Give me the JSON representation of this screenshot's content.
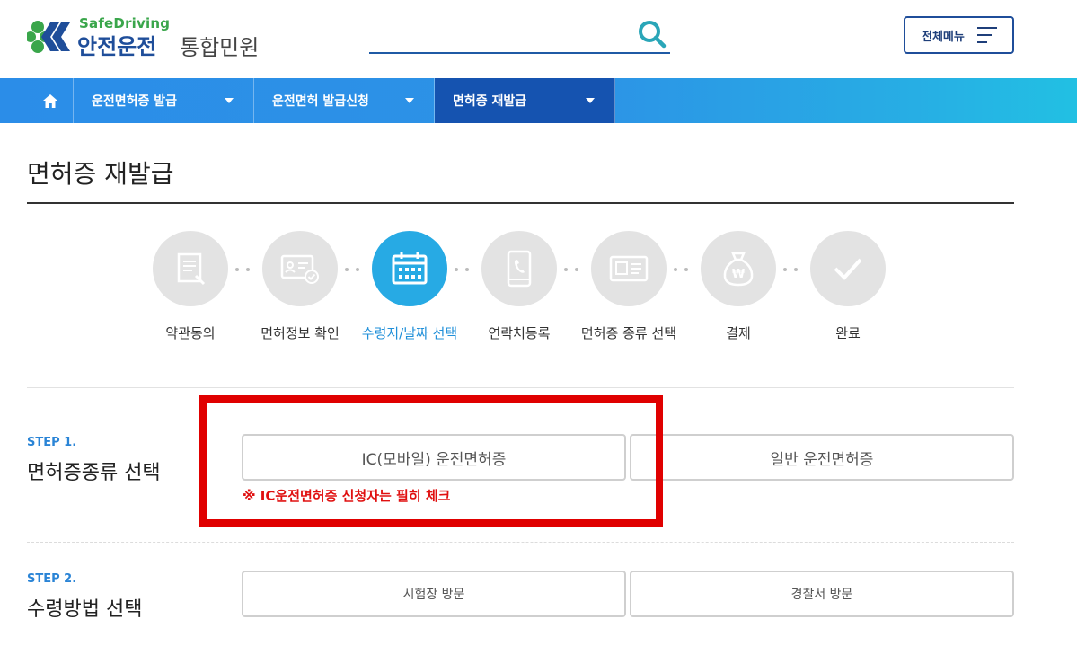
{
  "header": {
    "logo_safe": "SafeDriving",
    "logo_main": "안전운전",
    "logo_sub": "통합민원",
    "search_placeholder": "",
    "menu_label": "전체메뉴"
  },
  "nav": {
    "home_icon": "home-icon",
    "items": [
      {
        "label": "운전면허증 발급",
        "active": false
      },
      {
        "label": "운전면허 발급신청",
        "active": false
      },
      {
        "label": "면허증 재발급",
        "active": true
      }
    ]
  },
  "page": {
    "title": "면허증 재발급"
  },
  "progress": {
    "steps": [
      {
        "label": "약관동의",
        "icon": "document-edit-icon",
        "active": false
      },
      {
        "label": "면허정보 확인",
        "icon": "id-card-check-icon",
        "active": false
      },
      {
        "label": "수령지/날짜 선택",
        "icon": "calendar-icon",
        "active": true
      },
      {
        "label": "연락처등록",
        "icon": "phone-icon",
        "active": false
      },
      {
        "label": "면허증 종류 선택",
        "icon": "id-card-icon",
        "active": false
      },
      {
        "label": "결제",
        "icon": "money-bag-icon",
        "active": false
      },
      {
        "label": "완료",
        "icon": "check-icon",
        "active": false
      }
    ]
  },
  "step1": {
    "tag": "STEP 1.",
    "heading": "면허증종류 선택",
    "options": [
      "IC(모바일) 운전면허증",
      "일반 운전면허증"
    ],
    "notice": "※ IC운전면허증 신청자는 필히 체크"
  },
  "step2": {
    "tag": "STEP 2.",
    "heading": "수령방법 선택",
    "options": [
      "시험장 방문",
      "경찰서 방문"
    ]
  },
  "colors": {
    "primary": "#1f4e9a",
    "nav_gradient_start": "#2b8de8",
    "nav_active": "#1553b0",
    "step_active": "#27aae4",
    "notice": "#e01010",
    "highlight_box": "#e00000"
  }
}
